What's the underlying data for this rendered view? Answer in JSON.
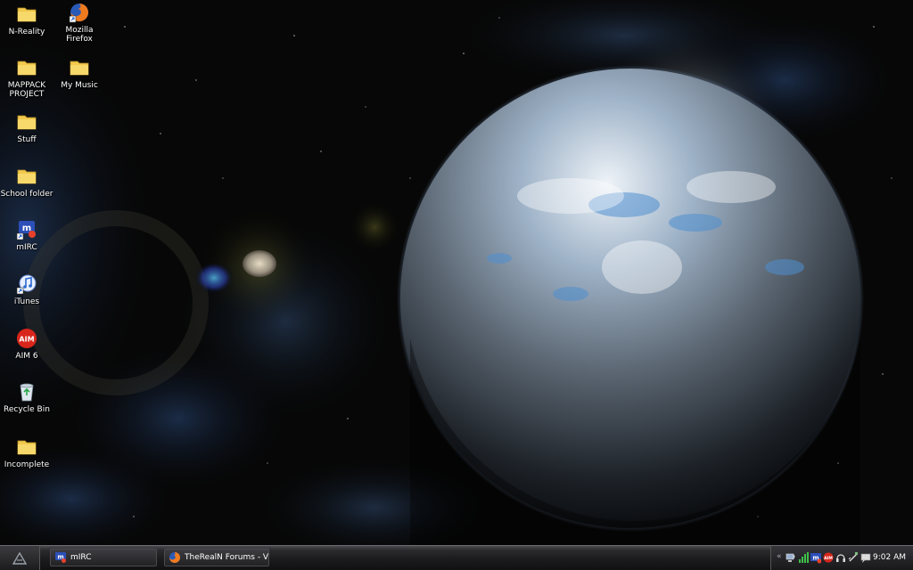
{
  "desktop": {
    "icons": [
      {
        "label": "N-Reality",
        "icon": "folder-icon"
      },
      {
        "label": "Mozilla Firefox",
        "icon": "firefox-icon"
      },
      {
        "label": "MAPPACK PROJECT",
        "icon": "folder-icon"
      },
      {
        "label": "My Music",
        "icon": "folder-icon"
      },
      {
        "label": "Stuff",
        "icon": "folder-icon"
      },
      {
        "label": "School folder",
        "icon": "folder-icon"
      },
      {
        "label": "mIRC",
        "icon": "mirc-icon"
      },
      {
        "label": "iTunes",
        "icon": "itunes-icon"
      },
      {
        "label": "AIM 6",
        "icon": "aim-icon"
      },
      {
        "label": "Recycle Bin",
        "icon": "recycle-bin-icon"
      },
      {
        "label": "Incomplete",
        "icon": "folder-icon"
      }
    ]
  },
  "taskbar": {
    "tasks": [
      {
        "label": "mIRC",
        "icon": "mirc-icon"
      },
      {
        "label": "TheRealN Forums - Vi...",
        "icon": "firefox-icon"
      }
    ],
    "tray": {
      "chevron": "«",
      "icons": [
        "network-icon",
        "signal-icon",
        "mirc-tray-icon",
        "aim-tray-icon",
        "headset-icon",
        "usb-icon",
        "message-icon"
      ],
      "clock": "9:02 AM"
    }
  },
  "colors": {
    "taskbar": "#1b1b1d",
    "folder": "#f2c94c",
    "text": "#ffffff"
  }
}
